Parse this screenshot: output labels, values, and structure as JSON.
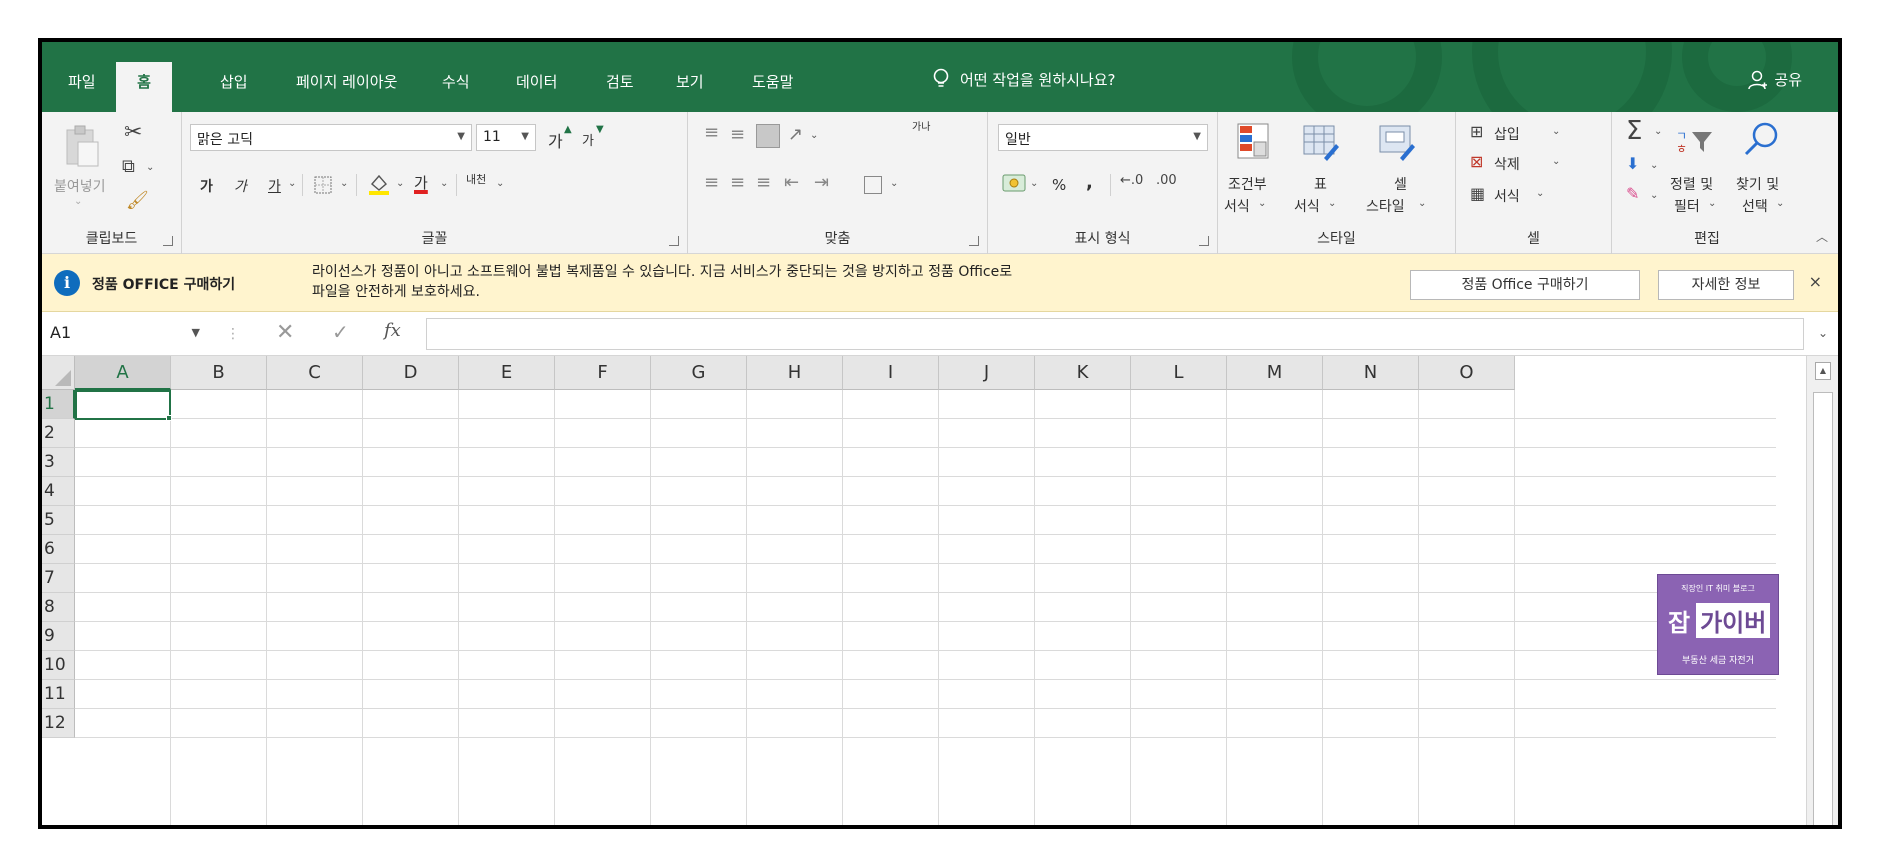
{
  "tabs": {
    "file": "파일",
    "home": "홈",
    "insert": "삽입",
    "page_layout": "페이지 레이아웃",
    "formulas": "수식",
    "data": "데이터",
    "review": "검토",
    "view": "보기",
    "help": "도움말",
    "tell_me": "어떤 작업을 원하시나요?",
    "share": "공유"
  },
  "ribbon": {
    "clipboard": {
      "paste_label": "붙여넣기",
      "group_label": "클립보드"
    },
    "font": {
      "font_name": "맑은 고딕",
      "font_size": "11",
      "grow_font": "가",
      "shrink_font": "가",
      "bold": "가",
      "italic": "가",
      "underline": "가",
      "font_color_glyph": "가",
      "phonetic": "내천",
      "group_label": "글꼴"
    },
    "alignment": {
      "wrap_glyph": "가나",
      "group_label": "맞춤"
    },
    "number": {
      "format": "일반",
      "percent": "%",
      "comma": ",",
      "group_label": "표시 형식"
    },
    "styles": {
      "conditional_line1": "조건부",
      "conditional_line2": "서식",
      "table_line1": "표",
      "table_line2": "서식",
      "cell_styles_line1": "셀",
      "cell_styles_line2": "스타일",
      "group_label": "스타일"
    },
    "cells": {
      "insert": "삽입",
      "delete": "삭제",
      "format": "서식",
      "group_label": "셀"
    },
    "editing": {
      "sort_line1": "정렬 및",
      "sort_line2": "필터",
      "find_line1": "찾기 및",
      "find_line2": "선택",
      "group_label": "편집"
    }
  },
  "message_bar": {
    "title": "정품 OFFICE 구매하기",
    "text_line1": "라이선스가 정품이 아니고 소프트웨어 불법 복제품일 수 있습니다. 지금 서비스가 중단되는 것을 방지하고 정품 Office로",
    "text_line2": "파일을 안전하게 보호하세요.",
    "buy_button": "정품 Office 구매하기",
    "details_button": "자세한 정보",
    "close": "×"
  },
  "formula_bar": {
    "name_box": "A1",
    "fx": "fx",
    "formula": ""
  },
  "grid": {
    "columns": [
      "A",
      "B",
      "C",
      "D",
      "E",
      "F",
      "G",
      "H",
      "I",
      "J",
      "K",
      "L",
      "M",
      "N",
      "O"
    ],
    "rows": [
      "1",
      "2",
      "3",
      "4",
      "5",
      "6",
      "7",
      "8",
      "9",
      "10",
      "11",
      "12"
    ],
    "active_cell": "A1"
  },
  "watermark": {
    "top": "직장인 IT 취미 블로그",
    "big1": "잡",
    "big2": "가이버",
    "bottom": "부동산 세금 자전거"
  },
  "colors": {
    "accent": "#217346",
    "message_bar": "#fff4ce",
    "watermark": "#8b63b3"
  }
}
